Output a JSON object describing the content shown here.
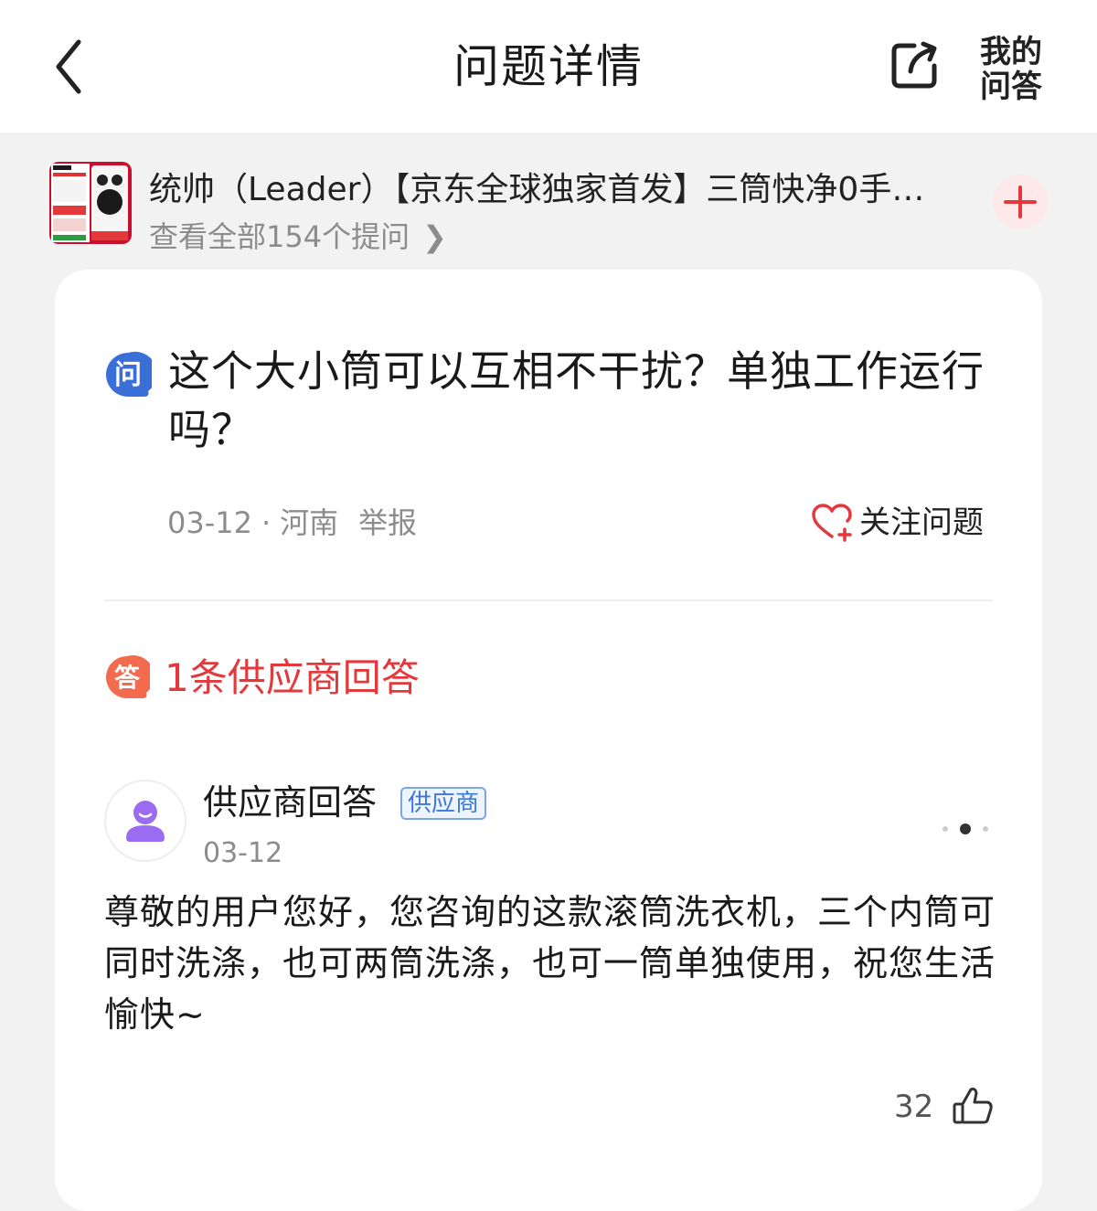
{
  "header": {
    "title": "问题详情",
    "my_qa_line1": "我的",
    "my_qa_line2": "问答",
    "icons": [
      "back-icon",
      "share-icon"
    ]
  },
  "product": {
    "name": "统帅（Leader）【京东全球独家首发】三筒快净0手…",
    "questions_link": "查看全部154个提问",
    "chevron": "❯",
    "add_symbol": "+"
  },
  "question": {
    "badge": "问",
    "text": "这个大小筒可以互相不干扰？单独工作运行吗？",
    "date": "03-12",
    "separator": "·",
    "location": "河南",
    "report_label": "举报",
    "follow_label": "关注问题"
  },
  "answers": {
    "badge": "答",
    "count_label": "1条供应商回答"
  },
  "answer": {
    "author": "供应商回答",
    "tag": "供应商",
    "date": "03-12",
    "text": "尊敬的用户您好，您咨询的这款滚筒洗衣机，三个内筒可同时洗涤，也可两筒洗涤，也可一筒单独使用，祝您生活愉快~",
    "likes": "32"
  },
  "colors": {
    "accent_red": "#e4393c",
    "answer_badge": "#f26b4f",
    "question_badge": "#3a6fd8",
    "supplier_tag": "#3a78d8",
    "avatar_purple": "#9b6cf2"
  }
}
